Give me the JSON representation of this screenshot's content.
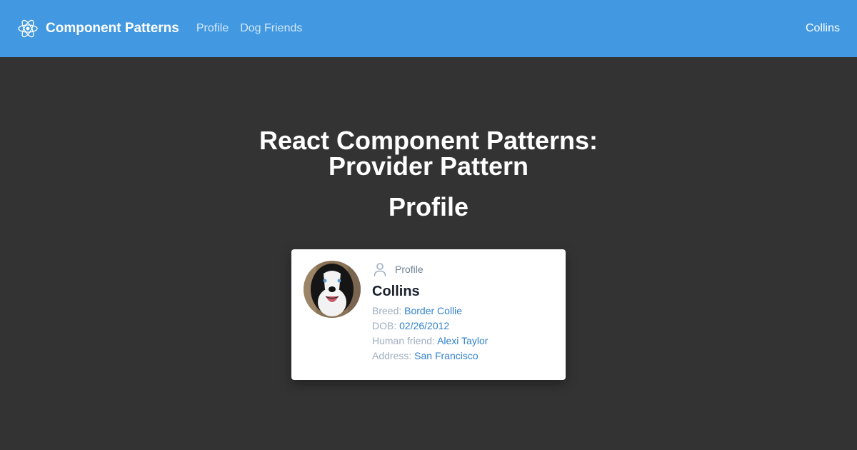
{
  "navbar": {
    "brand_icon": "react-atom-icon",
    "brand_title": "Component Patterns",
    "links": [
      {
        "label": "Profile"
      },
      {
        "label": "Dog Friends"
      }
    ],
    "user": "Collins"
  },
  "main": {
    "title_line1": "React Component Patterns:",
    "title_line2": "Provider Pattern",
    "section_title": "Profile"
  },
  "card": {
    "avatar": "dog-avatar",
    "label_icon": "user-icon",
    "label": "Profile",
    "name": "Collins",
    "details": [
      {
        "key": "Breed:",
        "value": "Border Collie"
      },
      {
        "key": "DOB:",
        "value": "02/26/2012"
      },
      {
        "key": "Human friend:",
        "value": "Alexi Taylor"
      },
      {
        "key": "Address:",
        "value": "San Francisco"
      }
    ]
  },
  "colors": {
    "navbar_bg": "#4299e1",
    "page_bg": "#333333",
    "link_value": "#3182ce",
    "detail_key": "#a0aec0"
  }
}
